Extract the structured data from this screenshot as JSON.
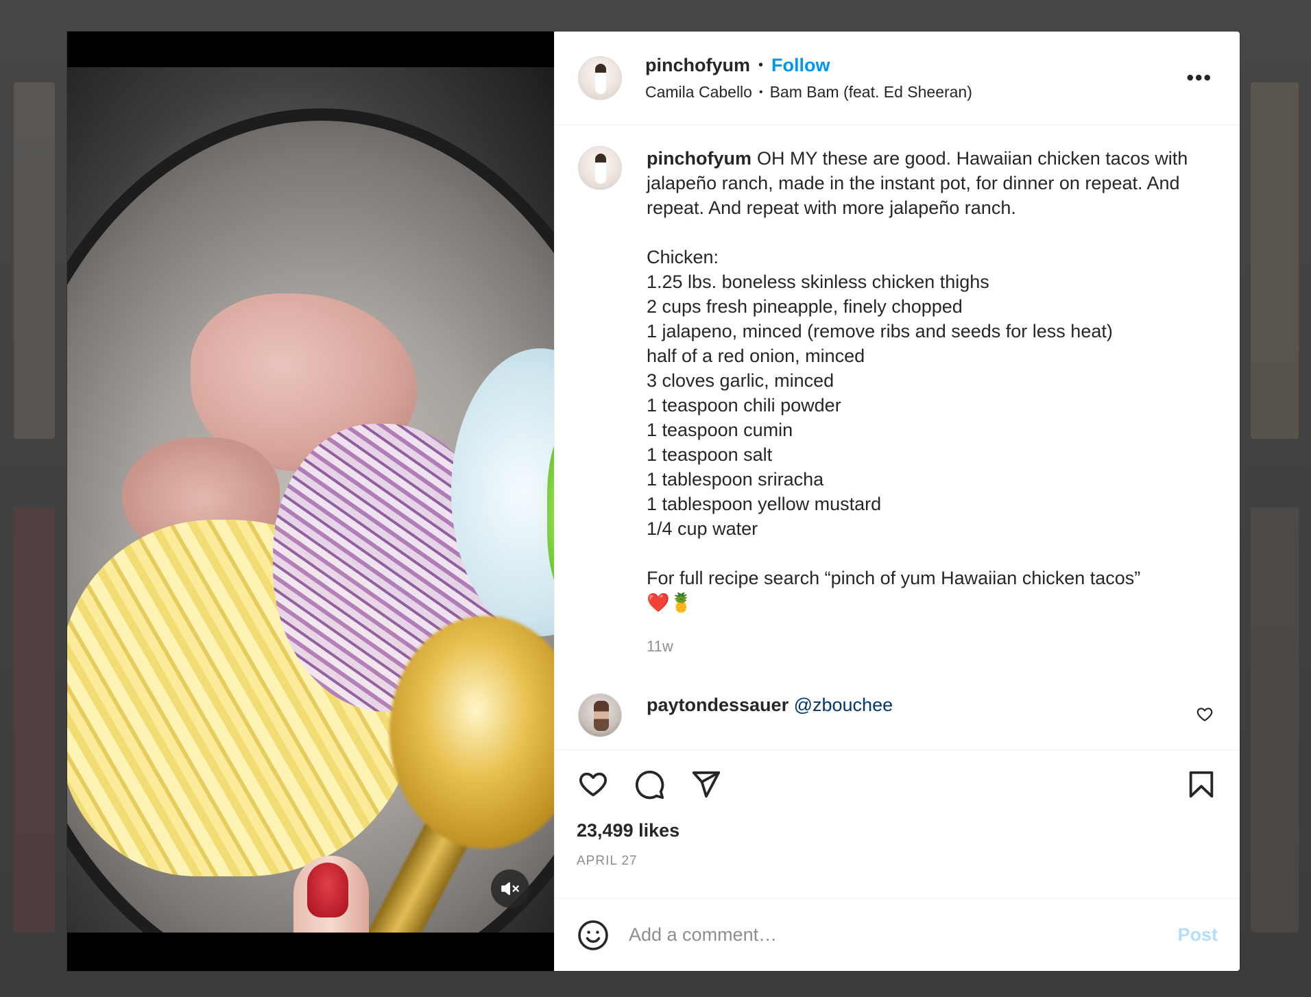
{
  "post": {
    "username": "pinchofyum",
    "follow_label": "Follow",
    "separator": "•",
    "audio_artist": "Camila Cabello",
    "audio_track": "Bam Bam (feat. Ed Sheeran)",
    "more_label": "•••",
    "caption_username": "pinchofyum",
    "caption_text": "OH MY these are good. Hawaiian chicken tacos with jalapeño ranch, made in the instant pot, for dinner on repeat. And repeat. And repeat with more jalapeño ranch.\n\nChicken:\n1.25 lbs. boneless skinless chicken thighs\n2 cups fresh pineapple, finely chopped\n1 jalapeno, minced (remove ribs and seeds for less heat)\nhalf of a red onion, minced\n3 cloves garlic, minced\n1 teaspoon chili powder\n1 teaspoon cumin\n1 teaspoon salt\n1 tablespoon sriracha\n1 tablespoon yellow mustard\n1/4 cup water\n\nFor full recipe search “pinch of yum Hawaiian chicken tacos”\n❤️🍍",
    "caption_time": "11w",
    "likes": "23,499 likes",
    "date": "APRIL 27"
  },
  "comments": [
    {
      "username": "paytondessauer",
      "mention": "@zbouchee"
    }
  ],
  "comment_box": {
    "placeholder": "Add a comment…",
    "post_label": "Post"
  },
  "icons": {
    "more": "more-horizontal-icon",
    "mute": "speaker-muted-icon",
    "like": "heart-icon",
    "comment": "comment-bubble-icon",
    "share": "paper-plane-icon",
    "save": "bookmark-icon",
    "emoji": "smiley-icon"
  },
  "colors": {
    "accent": "#0095f6",
    "post_disabled": "#b2dffc",
    "secondary_text": "#8e8e8e",
    "mention": "#00376b"
  }
}
